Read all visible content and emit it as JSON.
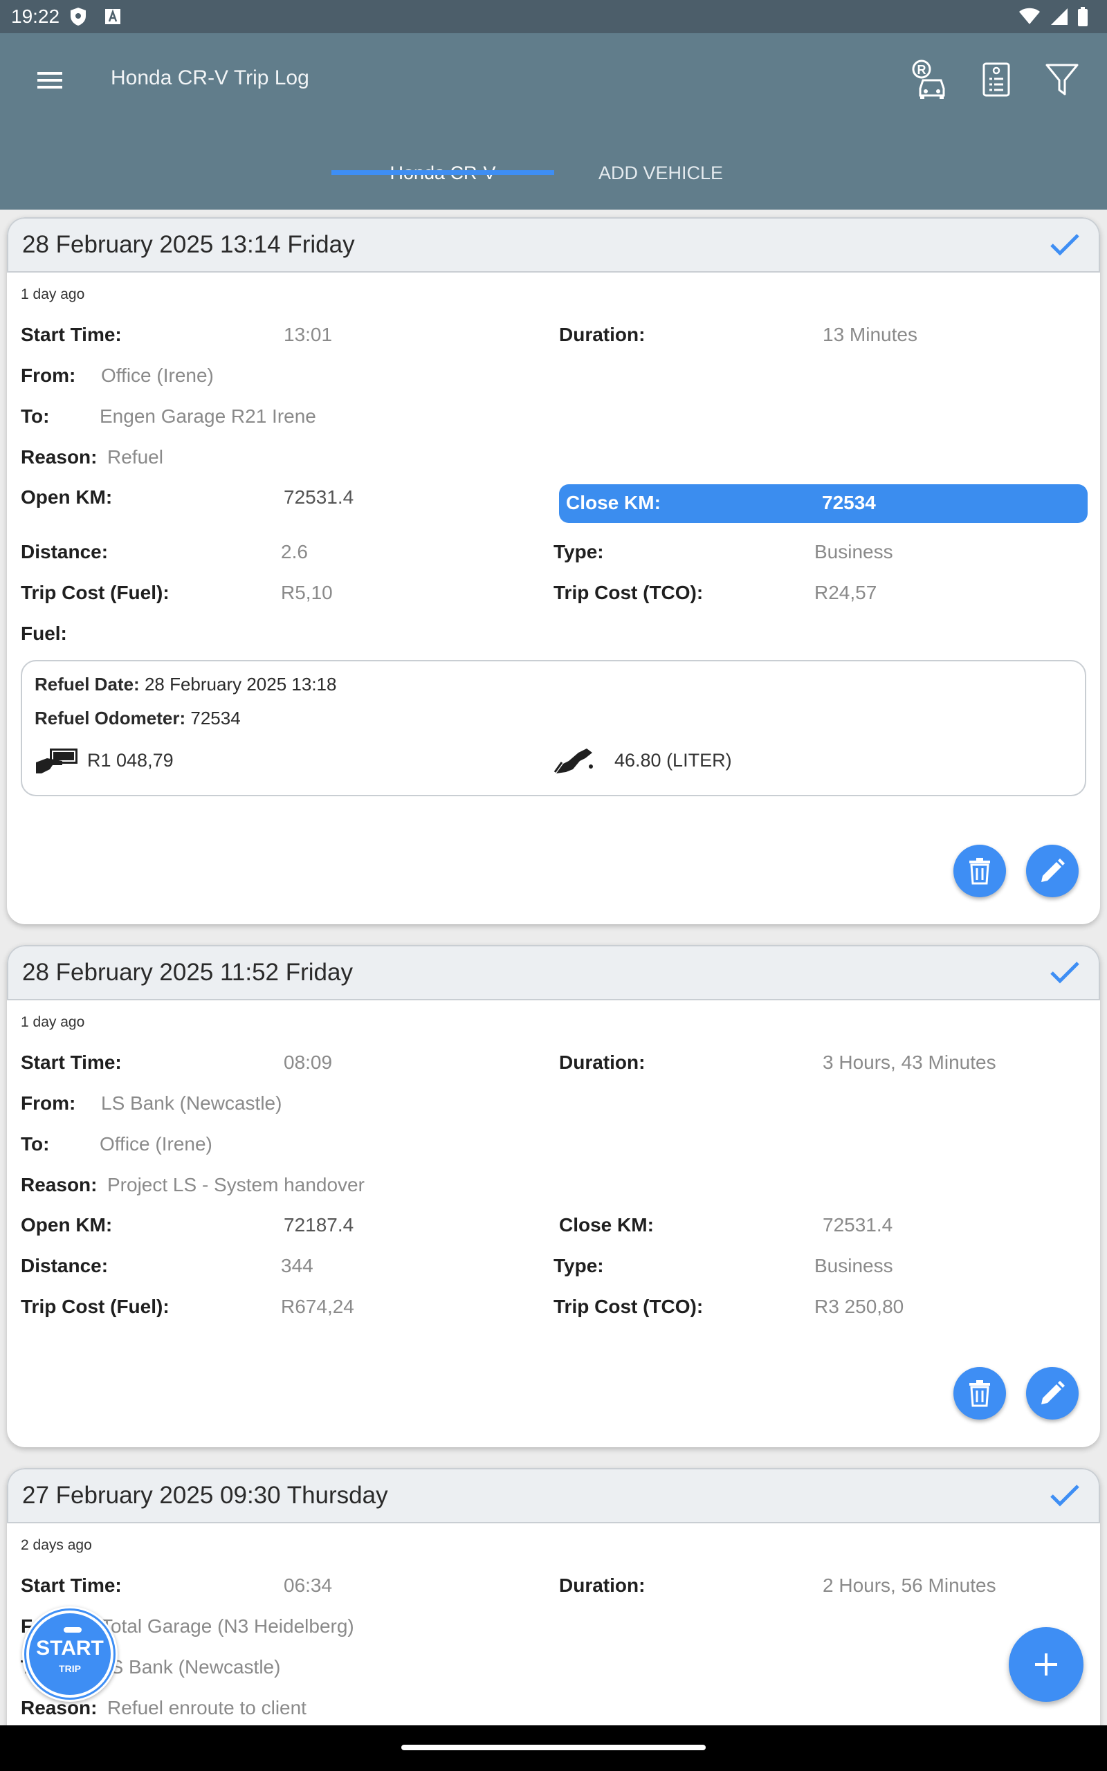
{
  "status_bar": {
    "time": "19:22"
  },
  "app_bar": {
    "title": "Honda CR-V Trip Log"
  },
  "tabs": [
    {
      "label": "Honda CR-V",
      "active": true
    },
    {
      "label": "ADD VEHICLE",
      "active": false
    }
  ],
  "labels": {
    "start_time": "Start Time:",
    "duration": "Duration:",
    "from": "From:",
    "to": "To:",
    "reason": "Reason:",
    "open_km": "Open KM:",
    "close_km": "Close KM:",
    "distance": "Distance:",
    "type": "Type:",
    "trip_cost_fuel": "Trip Cost (Fuel):",
    "trip_cost_tco": "Trip Cost (TCO):",
    "fuel": "Fuel:",
    "refuel_date": "Refuel Date:",
    "refuel_odometer": "Refuel Odometer:"
  },
  "trips": [
    {
      "header": "28 February 2025 13:14 Friday",
      "ago": "1 day ago",
      "start_time": "13:01",
      "duration": "13 Minutes",
      "from": "Office (Irene)",
      "to": "Engen Garage R21 Irene",
      "reason": "Refuel",
      "open_km": "72531.4",
      "close_km": "72534",
      "distance": "2.6",
      "type": "Business",
      "trip_cost_fuel": "R5,10",
      "trip_cost_tco": "R24,57",
      "refuel": {
        "date": "28 February 2025 13:18",
        "odometer": "72534",
        "cost": "R1 048,79",
        "quantity": "46.80 (LITER)"
      }
    },
    {
      "header": "28 February 2025 11:52 Friday",
      "ago": "1 day ago",
      "start_time": "08:09",
      "duration": "3 Hours, 43 Minutes",
      "from": "LS Bank (Newcastle)",
      "to": "Office (Irene)",
      "reason": "Project LS - System handover",
      "open_km": "72187.4",
      "close_km": "72531.4",
      "distance": "344",
      "type": "Business",
      "trip_cost_fuel": "R674,24",
      "trip_cost_tco": "R3 250,80"
    },
    {
      "header": "27 February 2025 09:30 Thursday",
      "ago": "2 days ago",
      "start_time": "06:34",
      "duration": "2 Hours, 56 Minutes",
      "from": "Total Garage (N3 Heidelberg)",
      "to": "LS Bank (Newcastle)",
      "reason": "Refuel enroute to client"
    }
  ],
  "start_button": {
    "label": "START",
    "sub": "TRIP"
  },
  "colors": {
    "app_bar": "#617d8b",
    "status_bar": "#4c5e6a",
    "accent": "#3e8ef4"
  }
}
